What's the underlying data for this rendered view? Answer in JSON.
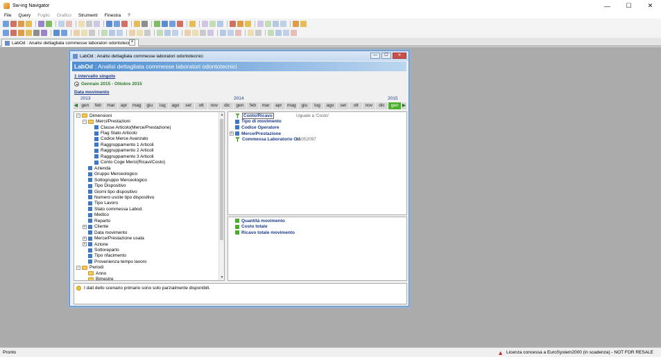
{
  "window": {
    "title": "Sw-ing Navigator",
    "min": "—",
    "max": "☐",
    "close": "✕"
  },
  "menu": [
    {
      "label": "File",
      "enabled": true
    },
    {
      "label": "Query",
      "enabled": true
    },
    {
      "label": "Foglio",
      "enabled": false
    },
    {
      "label": "Grafico",
      "enabled": false
    },
    {
      "label": "Strumenti",
      "enabled": true
    },
    {
      "label": "Finestra",
      "enabled": true
    },
    {
      "label": "?",
      "enabled": true
    }
  ],
  "doc_tab": {
    "label": "LabOd : Analisi dettagliata commesse laboratori odontotecnici",
    "add": "+"
  },
  "inner": {
    "title": "LabOd : Analisi dettagliata commesse laboratori odontotecnici",
    "banner_prefix": "LabOd",
    "banner_text": ": Analisi dettagliata commesse laboratori odontotecnici",
    "interval_link": "1 intervallo singolo",
    "interval_value": "Gennaio 2015 - Ottobre 2015",
    "date_link": "Data movimento",
    "years": [
      "2013",
      "2014",
      "2015"
    ],
    "months": [
      "gen",
      "feb",
      "mar",
      "apr",
      "mag",
      "giu",
      "lug",
      "ago",
      "set",
      "ott",
      "nov",
      "dic",
      "gen",
      "feb",
      "mar",
      "apr",
      "mag",
      "giu",
      "lug",
      "ago",
      "set",
      "ott",
      "nov",
      "dic",
      "gen"
    ],
    "selected_month": "gen",
    "tree": [
      {
        "label": "Dimensioni",
        "level": 0,
        "type": "folder",
        "exp": "−"
      },
      {
        "label": "Merci/Prestazioni",
        "level": 1,
        "type": "folder",
        "exp": "−"
      },
      {
        "label": "Classe Articolo(Merce/Prestazione)",
        "level": 2,
        "type": "dim",
        "exp": ""
      },
      {
        "label": "Flag Stato Articolo",
        "level": 2,
        "type": "dim",
        "exp": ""
      },
      {
        "label": "Codice Merce Avanzato",
        "level": 2,
        "type": "dim",
        "exp": ""
      },
      {
        "label": "Raggruppamento 1 Articoli",
        "level": 2,
        "type": "dim",
        "exp": ""
      },
      {
        "label": "Raggruppamento 2 Articoli",
        "level": 2,
        "type": "dim",
        "exp": ""
      },
      {
        "label": "Raggruppamento 3 Articoli",
        "level": 2,
        "type": "dim",
        "exp": ""
      },
      {
        "label": "Conto Coge Merci(Ricavi/Costo)",
        "level": 2,
        "type": "dim",
        "exp": ""
      },
      {
        "label": "Azienda",
        "level": 1,
        "type": "dim",
        "exp": ""
      },
      {
        "label": "Gruppo Merceologico",
        "level": 1,
        "type": "dim",
        "exp": ""
      },
      {
        "label": "Sottogruppo Merceologico",
        "level": 1,
        "type": "dim",
        "exp": ""
      },
      {
        "label": "Tipo Dispositivo",
        "level": 1,
        "type": "dim",
        "exp": ""
      },
      {
        "label": "Giorni tipo dispositivo",
        "level": 1,
        "type": "dim",
        "exp": ""
      },
      {
        "label": "Numero uscite tipo dispositivo",
        "level": 1,
        "type": "dim",
        "exp": ""
      },
      {
        "label": "Tipo Lavoro",
        "level": 1,
        "type": "dim",
        "exp": ""
      },
      {
        "label": "Stato commessa Labod.",
        "level": 1,
        "type": "dim",
        "exp": ""
      },
      {
        "label": "Medico",
        "level": 1,
        "type": "dim",
        "exp": ""
      },
      {
        "label": "Reparto",
        "level": 1,
        "type": "dim",
        "exp": ""
      },
      {
        "label": "Cliente",
        "level": 1,
        "type": "dim",
        "exp": "+"
      },
      {
        "label": "Data movimento",
        "level": 1,
        "type": "dim",
        "exp": ""
      },
      {
        "label": "Merce/Prestazione usata",
        "level": 1,
        "type": "dim",
        "exp": "+"
      },
      {
        "label": "Azione",
        "level": 1,
        "type": "dim",
        "exp": "+"
      },
      {
        "label": "Sottoreparto",
        "level": 1,
        "type": "dim",
        "exp": ""
      },
      {
        "label": "Tipo rifacimento",
        "level": 1,
        "type": "dim",
        "exp": ""
      },
      {
        "label": "Provenienza tempo lavoro",
        "level": 1,
        "type": "dim",
        "exp": ""
      },
      {
        "label": "Periodi",
        "level": 0,
        "type": "folder",
        "exp": "−"
      },
      {
        "label": "Anno",
        "level": 1,
        "type": "folder",
        "exp": ""
      },
      {
        "label": "Bimestre",
        "level": 1,
        "type": "folder",
        "exp": ""
      }
    ],
    "filters": [
      {
        "label": "Conto/Ricavo",
        "value": "Uguale a 'Costo'",
        "icon": "filter",
        "selected": true,
        "exp": ""
      },
      {
        "label": "Tipo di movimento",
        "value": "",
        "icon": "dim",
        "selected": false,
        "exp": ""
      },
      {
        "label": "Codice Operatore",
        "value": "",
        "icon": "dim",
        "selected": false,
        "exp": ""
      },
      {
        "label": "Merce/Prestazione",
        "value": "",
        "icon": "dim",
        "selected": false,
        "exp": "+"
      },
      {
        "label": "Commessa Laboratorio Od.",
        "value": "15052097",
        "icon": "filter",
        "selected": false,
        "exp": ""
      }
    ],
    "measures": [
      "Quantità movimento",
      "Costo totale",
      "Ricavo totale movimento"
    ],
    "message": "I dati dello scenario primario sono solo parzialmente disponibili."
  },
  "status": {
    "left": "Pronto",
    "license": "Licenza concessa a EuroSystem2000 (in scadenza) - NOT FOR RESALE"
  },
  "colors": {
    "accent": "#4d8dd1",
    "selected_month": "#4caf2a",
    "link": "#1a3a8c"
  }
}
